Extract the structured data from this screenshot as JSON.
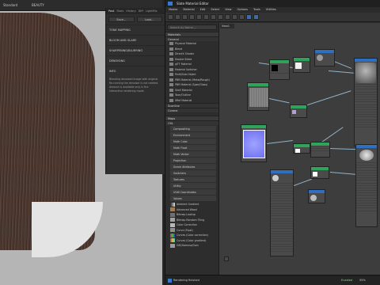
{
  "viewport": {
    "label_left": "Standard",
    "label_mid": "BEAUTY"
  },
  "render_panel": {
    "tabs": [
      "Post",
      "Stats",
      "History",
      "Diff",
      "LightMix"
    ],
    "buttons": [
      "Save...",
      "Load..."
    ],
    "sections": [
      "TONE MAPPING",
      "BLOOM AND GLARE",
      "SHARPENING/BLURRING",
      "DENOISING",
      "INFO"
    ],
    "info_text": "Blending denoised image with original. Re-running the denoiser is not needed. Amount is available only in the interactive rendering mode."
  },
  "slate": {
    "title": "Slate Material Editor",
    "menu": [
      "Modes",
      "Material",
      "Edit",
      "Select",
      "View",
      "Options",
      "Tools",
      "Utilities"
    ],
    "view_tab": "View1",
    "search_placeholder": "Search by Name ...",
    "groups": {
      "materials": "Materials",
      "general": "General",
      "scanline": "Scanline",
      "corona": "Corona",
      "maps": "Maps",
      "osl": "OSL"
    },
    "general_items": [
      "Physical Material",
      "Blend",
      "DirectX Shader",
      "Double Sided",
      "glTF Material",
      "Material Switcher",
      "Multi/Sub-Object",
      "PBR Material (Metal/Rough)",
      "PBR Material (Spec/Gloss)",
      "Shell Material",
      "Toon/Outline",
      "XRef Material"
    ],
    "osl_items": [
      "Compositing",
      "Environment",
      "Math Color",
      "Math Float",
      "Math Vector",
      "Projection",
      "Scene Attributes",
      "Switchers",
      "Textures",
      "Utility",
      "UVW Coordinates",
      "Values"
    ],
    "map_items": [
      "Ambient Gradient",
      "Advanced Wood",
      "Bitmap Lookup",
      "Bitmap Random Tiling",
      "Color Correction",
      "Curve (Float)",
      "Curves (Color correction)",
      "Curves (Color gradient)",
      "Gift/Gamma/Gain"
    ],
    "status_text": "Rendering finished",
    "status_right": "Enabled",
    "zoom": "55%"
  },
  "colors": {
    "node_header_green": "#2fa35a",
    "node_header_blue": "#2f6fbf",
    "accent_blue": "#3c77c8"
  }
}
